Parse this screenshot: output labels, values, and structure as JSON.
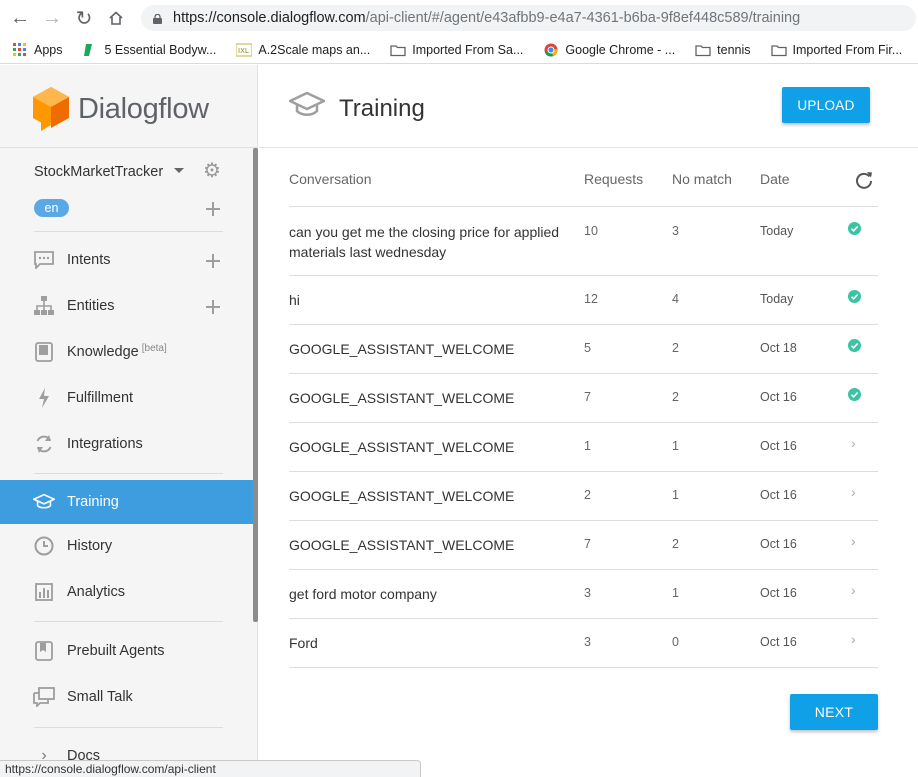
{
  "browser": {
    "url_host": "https://console.dialogflow.com",
    "url_path": "/api-client/#/agent/e43afbb9-e4a7-4361-b6ba-9f8ef448c589/training",
    "status_url": "https://console.dialogflow.com/api-client"
  },
  "bookmarks": [
    {
      "label": "Apps",
      "icon": "apps-grid-icon"
    },
    {
      "label": "5 Essential Bodyw...",
      "icon": "bookmark-icon"
    },
    {
      "label": "A.2Scale maps an...",
      "icon": "bookmark-icon"
    },
    {
      "label": "Imported From Sa...",
      "icon": "folder-icon"
    },
    {
      "label": "Google Chrome - ...",
      "icon": "chrome-icon"
    },
    {
      "label": "tennis",
      "icon": "folder-icon"
    },
    {
      "label": "Imported From Fir...",
      "icon": "folder-icon"
    }
  ],
  "sidebar": {
    "brand": "Dialogflow",
    "agent_name": "StockMarketTracker",
    "language": "en",
    "items": [
      {
        "label": "Intents",
        "icon": "chat-icon"
      },
      {
        "label": "Entities",
        "icon": "hierarchy-icon"
      },
      {
        "label": "Knowledge",
        "badge": "[beta]",
        "icon": "book-icon"
      },
      {
        "label": "Fulfillment",
        "icon": "bolt-icon"
      },
      {
        "label": "Integrations",
        "icon": "sync-icon"
      },
      {
        "label": "Training",
        "icon": "graduation-cap-icon"
      },
      {
        "label": "History",
        "icon": "clock-icon"
      },
      {
        "label": "Analytics",
        "icon": "bar-chart-icon"
      },
      {
        "label": "Prebuilt Agents",
        "icon": "bookmark-book-icon"
      },
      {
        "label": "Small Talk",
        "icon": "chat-bubbles-icon"
      },
      {
        "label": "Docs",
        "icon": "chevron-right-icon"
      }
    ]
  },
  "main": {
    "title": "Training",
    "upload_label": "UPLOAD",
    "next_label": "NEXT",
    "columns": [
      "Conversation",
      "Requests",
      "No match",
      "Date"
    ],
    "rows": [
      {
        "conversation": "can you get me the closing price for applied materials last wednesday",
        "requests": "10",
        "no_match": "3",
        "date": "Today",
        "status": "done"
      },
      {
        "conversation": "hi",
        "requests": "12",
        "no_match": "4",
        "date": "Today",
        "status": "done"
      },
      {
        "conversation": "GOOGLE_ASSISTANT_WELCOME",
        "requests": "5",
        "no_match": "2",
        "date": "Oct 18",
        "status": "done"
      },
      {
        "conversation": "GOOGLE_ASSISTANT_WELCOME",
        "requests": "7",
        "no_match": "2",
        "date": "Oct 16",
        "status": "done"
      },
      {
        "conversation": "GOOGLE_ASSISTANT_WELCOME",
        "requests": "1",
        "no_match": "1",
        "date": "Oct 16",
        "status": "open"
      },
      {
        "conversation": "GOOGLE_ASSISTANT_WELCOME",
        "requests": "2",
        "no_match": "1",
        "date": "Oct 16",
        "status": "open"
      },
      {
        "conversation": "GOOGLE_ASSISTANT_WELCOME",
        "requests": "7",
        "no_match": "2",
        "date": "Oct 16",
        "status": "open"
      },
      {
        "conversation": "get ford motor company",
        "requests": "3",
        "no_match": "1",
        "date": "Oct 16",
        "status": "open"
      },
      {
        "conversation": "Ford",
        "requests": "3",
        "no_match": "0",
        "date": "Oct 16",
        "status": "open"
      }
    ]
  },
  "colors": {
    "accent": "#0fa0e8",
    "active_nav": "#3d9ddf",
    "check": "#3cc3a3",
    "logo_orange": "#f57c00"
  }
}
